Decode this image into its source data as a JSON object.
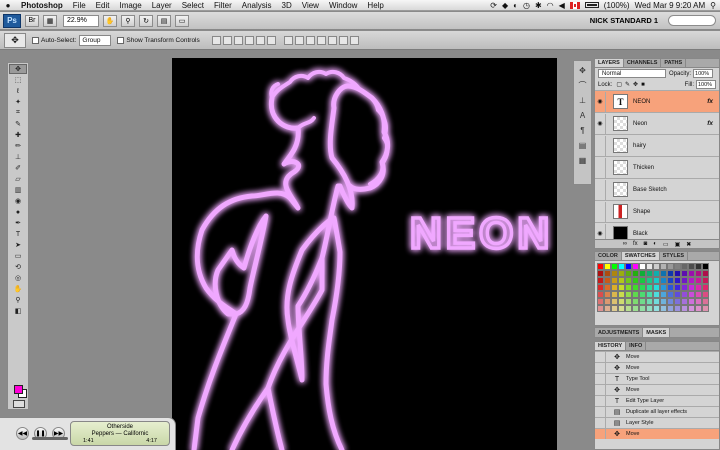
{
  "menubar": {
    "app": "Photoshop",
    "items": [
      "File",
      "Edit",
      "Image",
      "Layer",
      "Select",
      "Filter",
      "Analysis",
      "3D",
      "View",
      "Window",
      "Help"
    ],
    "battery": "(100%)",
    "clock": "Wed Mar 9  9:20 AM"
  },
  "appbar": {
    "logo": "Ps",
    "zoom": "22.9%",
    "workspace": "NICK STANDARD 1"
  },
  "options": {
    "auto_select_label": "Auto-Select:",
    "auto_select_value": "Group",
    "show_transform": "Show Transform Controls"
  },
  "canvas": {
    "neon_text": "NEON",
    "glow_color": "#f0a8ff"
  },
  "layers_panel": {
    "tabs": [
      "LAYERS",
      "CHANNELS",
      "PATHS"
    ],
    "blend_mode": "Normal",
    "opacity_label": "Opacity:",
    "opacity_value": "100%",
    "lock_label": "Lock:",
    "fill_label": "Fill:",
    "fill_value": "100%",
    "layers": [
      {
        "name": "NEON",
        "fx": "fx",
        "selected": true,
        "visible": true
      },
      {
        "name": "Neon",
        "fx": "fx",
        "selected": false,
        "visible": true
      },
      {
        "name": "hairy",
        "fx": "",
        "selected": false,
        "visible": false
      },
      {
        "name": "Thicken",
        "fx": "",
        "selected": false,
        "visible": false
      },
      {
        "name": "Base Sketch",
        "fx": "",
        "selected": false,
        "visible": false
      },
      {
        "name": "Shape",
        "fx": "",
        "selected": false,
        "visible": false
      },
      {
        "name": "Black",
        "fx": "",
        "selected": false,
        "visible": true
      }
    ]
  },
  "swatches_panel": {
    "tabs": [
      "COLOR",
      "SWATCHES",
      "STYLES"
    ]
  },
  "adjust_panel": {
    "tabs": [
      "ADJUSTMENTS",
      "MASKS"
    ]
  },
  "history_panel": {
    "tabs": [
      "HISTORY",
      "INFO"
    ],
    "items": [
      {
        "label": "Move",
        "icon": "move"
      },
      {
        "label": "Move",
        "icon": "move"
      },
      {
        "label": "Type Tool",
        "icon": "type"
      },
      {
        "label": "Move",
        "icon": "move"
      },
      {
        "label": "Edit Type Layer",
        "icon": "type"
      },
      {
        "label": "Duplicate all layer effects",
        "icon": "doc"
      },
      {
        "label": "Layer Style",
        "icon": "doc"
      },
      {
        "label": "Move",
        "icon": "move",
        "selected": true
      }
    ]
  },
  "itunes": {
    "song": "Otherside",
    "artist": "Peppers — Californic",
    "elapsed": "1:41",
    "total": "4:17",
    "progress": 0.39
  },
  "colors": {
    "foreground": "#ff00d8",
    "background": "#ffffff",
    "selection": "#f7a27b"
  }
}
